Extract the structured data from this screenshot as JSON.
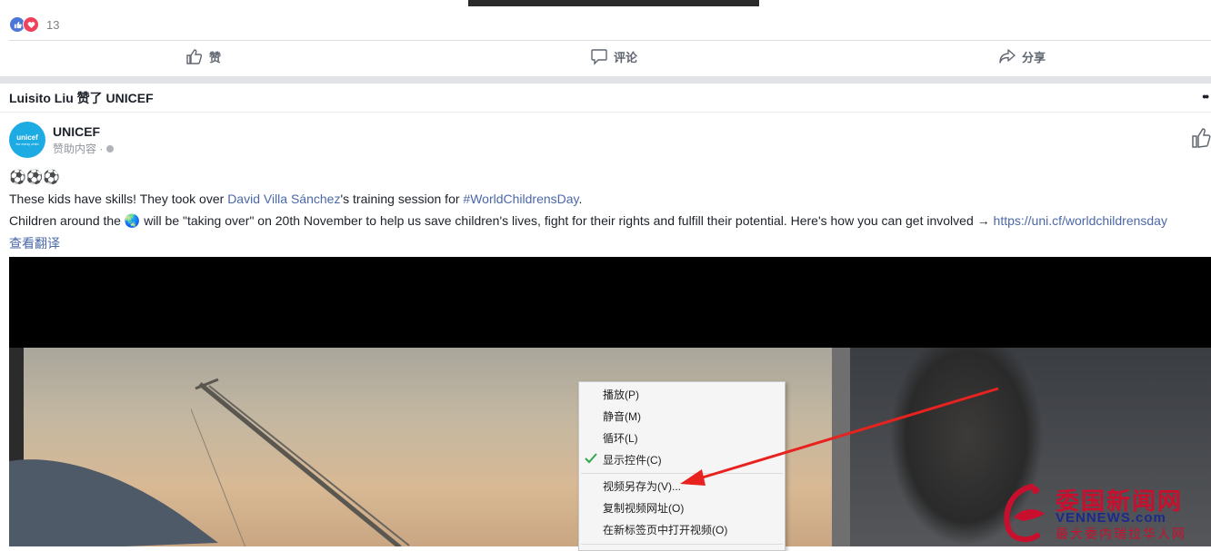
{
  "post_top": {
    "reaction_count": "13",
    "actions": {
      "like": "赞",
      "comment": "评论",
      "share": "分享"
    }
  },
  "story": {
    "header": "Luisito Liu 赞了 UNICEF",
    "more": "••",
    "page": {
      "avatar_text": "unicef",
      "avatar_subtext": "for every child",
      "name": "UNICEF",
      "sponsored": "赞助内容 ·"
    },
    "emoji": "⚽⚽⚽",
    "line1": {
      "pre": "These kids have skills! They took over ",
      "link1": "David Villa Sánchez",
      "mid": "'s training session for ",
      "link2": "#WorldChildrensDay",
      "post": "."
    },
    "line2": {
      "pre": "Children around the ",
      "emoji": "🌏",
      "mid": " will be \"taking over\" on 20th November to help us save children's lives, fight for their rights and fulfill their potential. Here's how you can get involved → ",
      "link": "https://uni.cf/worldchildrensday"
    },
    "translate": "查看翻译"
  },
  "context_menu": {
    "items": [
      "播放(P)",
      "静音(M)",
      "循环(L)",
      "显示控件(C)",
      "视频另存为(V)...",
      "复制视频网址(O)",
      "在新标签页中打开视频(O)"
    ],
    "checked_item": "显示控件(C)"
  },
  "watermark": {
    "title": "委国新闻网",
    "domain": "VENNEWS.com",
    "tagline": "最大委内瑞拉华人网"
  },
  "colors": {
    "link": "#4b68a8",
    "arrow": "#e8231f",
    "watermark_red": "#c8102e",
    "unicef_blue": "#1cabe2"
  },
  "icons": [
    "like-icon",
    "love-icon",
    "thumbs-up-icon",
    "comment-icon",
    "share-icon",
    "globe-icon",
    "checkmark-icon"
  ]
}
